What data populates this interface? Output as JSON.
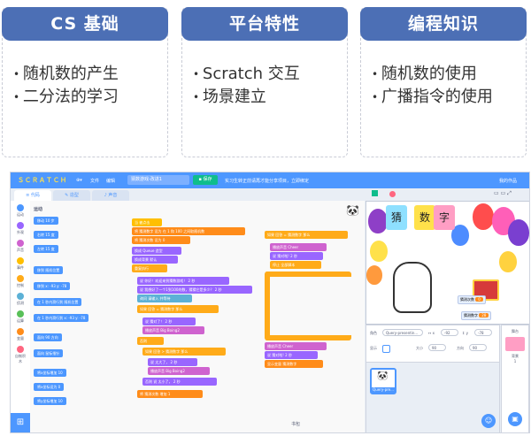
{
  "cards": [
    {
      "title": "CS 基础",
      "items": [
        "随机数的产生",
        "二分法的学习"
      ]
    },
    {
      "title": "平台特性",
      "items": [
        "Scratch 交互",
        "场景建立"
      ]
    },
    {
      "title": "编程知识",
      "items": [
        "随机数的使用",
        "广播指令的使用"
      ]
    }
  ],
  "editor": {
    "logo": "ＳＣＲＡＴＣＨ",
    "menu": {
      "file": "文件",
      "edit": "编辑"
    },
    "project_title": "猜数游戏-改进1",
    "save": "保存",
    "promo": "实习生转正前请再才能分享项目，立即绑定",
    "my_works": "我的作品",
    "tabs": {
      "code": "代码",
      "costumes": "造型",
      "sounds": "声音"
    },
    "categories": [
      {
        "label": "运动",
        "color": "#4c97ff"
      },
      {
        "label": "外观",
        "color": "#9966ff"
      },
      {
        "label": "声音",
        "color": "#cf63cf"
      },
      {
        "label": "事件",
        "color": "#ffbf00"
      },
      {
        "label": "控制",
        "color": "#ffab19"
      },
      {
        "label": "侦测",
        "color": "#5cb1d6"
      },
      {
        "label": "运算",
        "color": "#59c059"
      },
      {
        "label": "变量",
        "color": "#ff8c1a"
      },
      {
        "label": "自制积木",
        "color": "#ff6680"
      }
    ],
    "palette_section": "运动",
    "palette_blocks": [
      "移动 10 步",
      "右转 15 度",
      "左转 15 度",
      "移到 随机位置",
      "移到 x: -93 y: -78",
      "在 1 秒内滑行到 随机位置",
      "在 1 秒内滑行到 x: -93 y: -78",
      "面向 90 方向",
      "面向 鼠标指针",
      "将x坐标增加 10",
      "将x坐标设为 0",
      "将y坐标增加 10"
    ],
    "script_blocks": [
      {
        "label": "当 被点击",
        "cls": "ev"
      },
      {
        "label": "将 猜测数字 设为 在 1 和 100 之间取随机数",
        "cls": "vr"
      },
      {
        "label": "将 猜测次数 设为 0",
        "cls": "vr"
      },
      {
        "label": "换成 Queue 造型",
        "cls": "lk"
      },
      {
        "label": "换成背景 默认",
        "cls": "lk"
      },
      {
        "label": "重复执行",
        "cls": "ct"
      },
      {
        "label": "说 你好！欢迎来到猜数游戏！ 2 秒",
        "cls": "lk"
      },
      {
        "label": "说 我想好了一个1到100的数，猜猜它是多少？ 2 秒",
        "cls": "lk"
      },
      {
        "label": "询问 请输入 并等待",
        "cls": "sensing"
      },
      {
        "label": "如果 回答 = 猜测数字 那么",
        "cls": "ct"
      },
      {
        "label": "说 猜对了！ 2 秒",
        "cls": "lk"
      },
      {
        "label": "播放声音 Big Boing2",
        "cls": "sn"
      },
      {
        "label": "否则",
        "cls": "ct"
      },
      {
        "label": "如果 回答 > 猜测数字 那么",
        "cls": "ct"
      },
      {
        "label": "说 太大了， 2 秒",
        "cls": "lk"
      },
      {
        "label": "播放声音 Big Boing2",
        "cls": "sn"
      },
      {
        "label": "否则 说 太小了， 2 秒",
        "cls": "lk"
      },
      {
        "label": "将 猜测次数 增加 1",
        "cls": "vr"
      },
      {
        "label": "如果 回答 = 猜测数字 那么",
        "cls": "ct"
      },
      {
        "label": "播放声音 Cheer",
        "cls": "sn"
      },
      {
        "label": "说 猜对啦! 2 秒",
        "cls": "lk"
      },
      {
        "label": "停止 全部脚本",
        "cls": "ct"
      }
    ],
    "backpack": "书包",
    "stage": {
      "banner": [
        "猜",
        "数",
        "字"
      ],
      "var_guess_count_label": "猜测次数",
      "var_guess_count_value": "0",
      "var_guess_number_label": "猜测数字",
      "var_guess_number_value": "28"
    },
    "sprite": {
      "label_sprite": "角色",
      "name": "Query-presentin...",
      "x_label": "x",
      "x": "-92",
      "y_label": "y",
      "y": "-78",
      "show_label": "显示",
      "size_label": "大小",
      "size": "90",
      "dir_label": "方向",
      "dir": "90",
      "thumb_label": "Query-pre..."
    },
    "stage_panel": {
      "title": "舞台",
      "backdrops_label": "背景",
      "backdrops": "1"
    }
  }
}
